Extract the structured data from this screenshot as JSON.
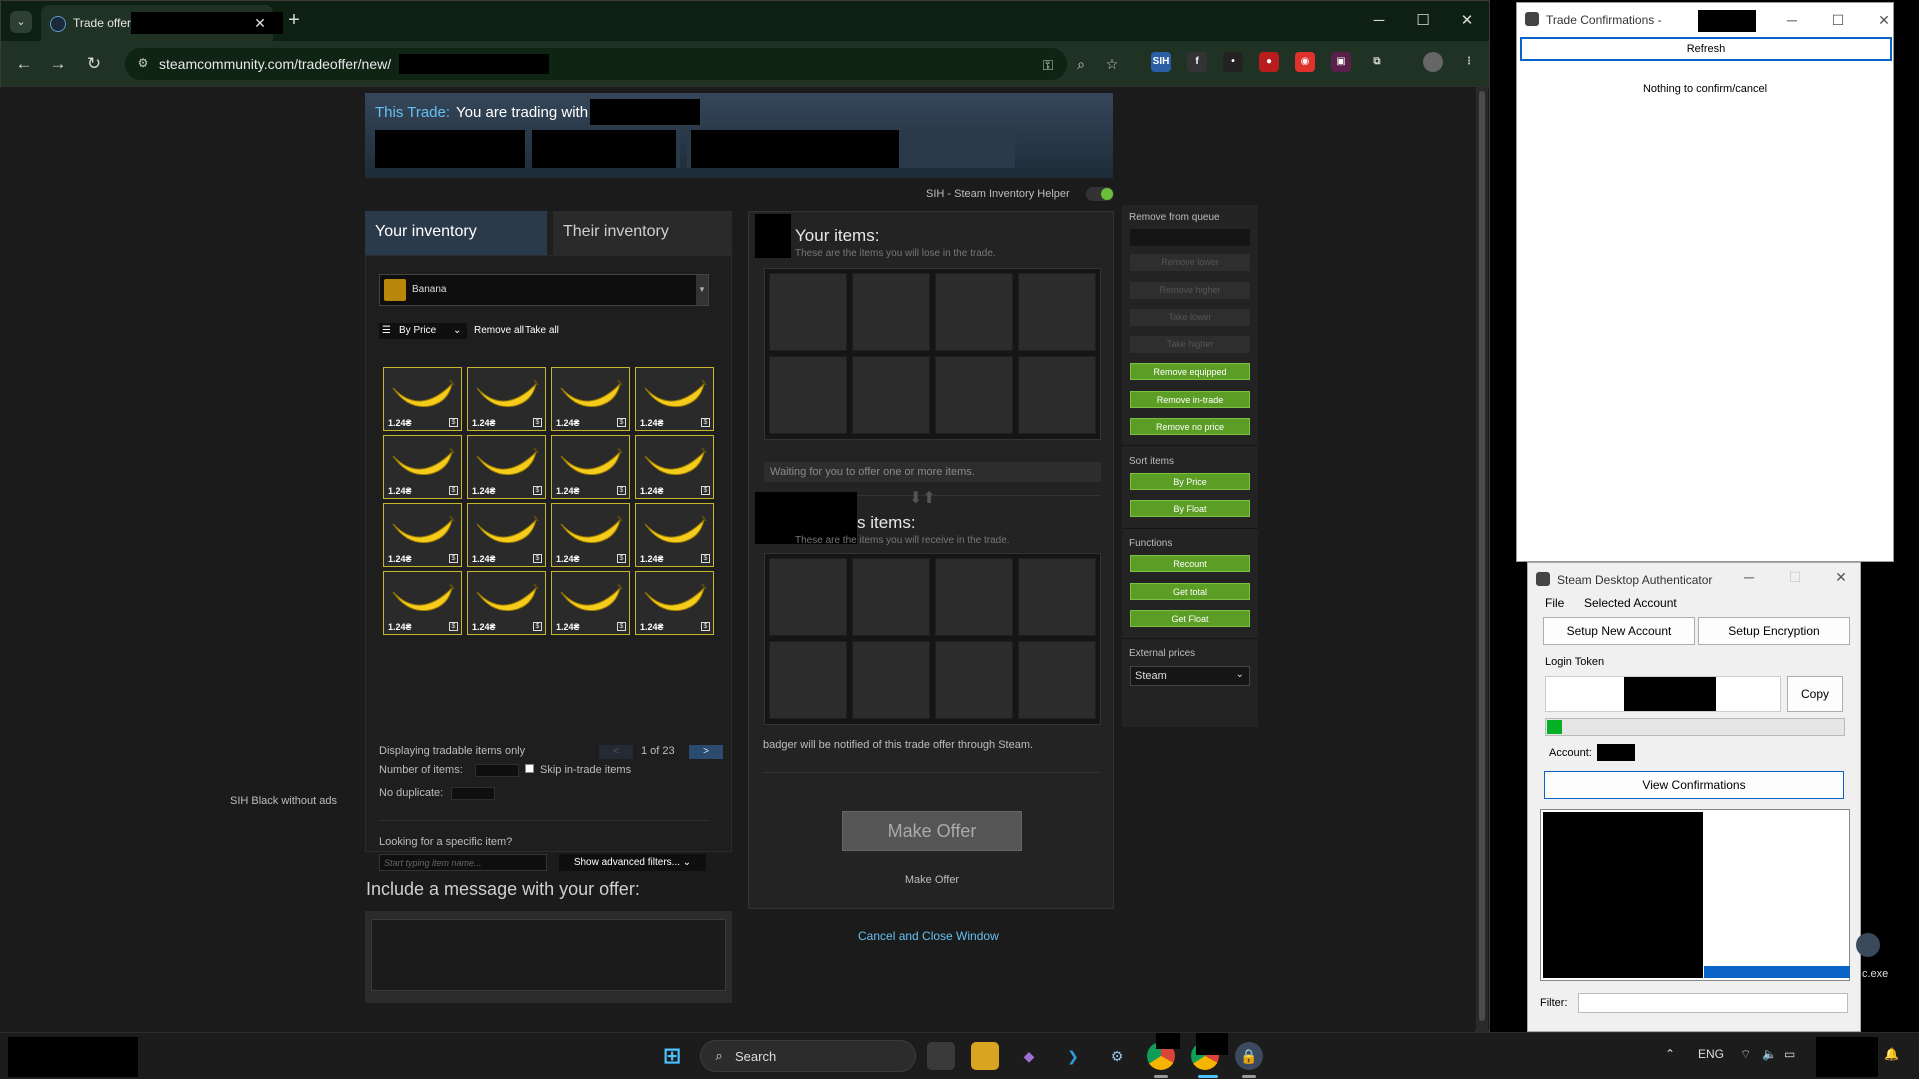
{
  "browser": {
    "tab_title": "Trade offer",
    "tab_close": "✕",
    "newtab": "+",
    "url": "steamcommunity.com/tradeoffer/new/",
    "win": {
      "min": "─",
      "max": "☐",
      "close": "✕"
    },
    "nav": {
      "back": "←",
      "forward": "→",
      "reload": "↻"
    },
    "extensions": [
      "SIH",
      "f",
      "•",
      "●",
      "◉",
      "▣",
      "⧉"
    ]
  },
  "trade": {
    "label": "This Trade:",
    "trading_with": "You are trading with",
    "sih_label": "SIH - Steam Inventory Helper"
  },
  "inventory": {
    "tab_yours": "Your inventory",
    "tab_theirs": "Their inventory",
    "game": "Banana",
    "sort_label": "By Price",
    "remove_all": "Remove all",
    "take_all": "Take all",
    "item_price": "1.24₴",
    "item_count_shown": 16,
    "tradable_only": "Displaying tradable items only",
    "page": "1 of 23",
    "prev": "<",
    "next": ">",
    "number_of_items": "Number of items:",
    "skip_in_trade": "Skip in-trade items",
    "no_duplicate": "No duplicate:",
    "looking_for": "Looking for a specific item?",
    "search_placeholder": "Start typing item name...",
    "advanced_filters": "Show advanced filters... ⌄"
  },
  "sih_black": "SIH Black without ads",
  "message": {
    "title": "Include a message with your offer:"
  },
  "trade_area": {
    "your_items_title": "Your items:",
    "your_items_sub": "These are the items you will lose in the trade.",
    "waiting": "Waiting for you to offer one or more items.",
    "their_items_title": "s items:",
    "their_items_sub": "These are the items you will receive in the trade.",
    "notify": "badger will be notified of this trade offer through Steam.",
    "make_offer_button": "Make Offer",
    "make_offer_label": "Make Offer",
    "cancel": "Cancel and Close Window"
  },
  "sih_panel": {
    "remove_queue": "Remove from queue",
    "disabled_buttons": [
      "Remove lower",
      "Remove higher",
      "Take lower",
      "Take higher"
    ],
    "active_buttons": [
      "Remove equipped",
      "Remove in-trade",
      "Remove no price"
    ],
    "sort_items": "Sort items",
    "sort_buttons": [
      "By Price",
      "By Float"
    ],
    "functions": "Functions",
    "function_buttons": [
      "Recount",
      "Get total",
      "Get Float"
    ],
    "external_prices": "External prices",
    "external_value": "Steam"
  },
  "confirmations": {
    "title": "Trade Confirmations -",
    "refresh": "Refresh",
    "empty": "Nothing to confirm/cancel"
  },
  "sda": {
    "title": "Steam Desktop Authenticator",
    "menu_file": "File",
    "menu_selected": "Selected Account",
    "setup_new": "Setup New Account",
    "setup_enc": "Setup Encryption",
    "login_token": "Login Token",
    "copy": "Copy",
    "token_progress": 0.05,
    "account": "Account:",
    "view_conf": "View Confirmations",
    "filter": "Filter:"
  },
  "desktop": {
    "exe_label": "c.exe"
  },
  "taskbar": {
    "search": "Search",
    "lang": "ENG",
    "colors": {
      "windows": "#4cc2ff",
      "vs": "#9b6fd6",
      "vscode": "#2d9de0",
      "chrome": "#e6b800"
    }
  }
}
